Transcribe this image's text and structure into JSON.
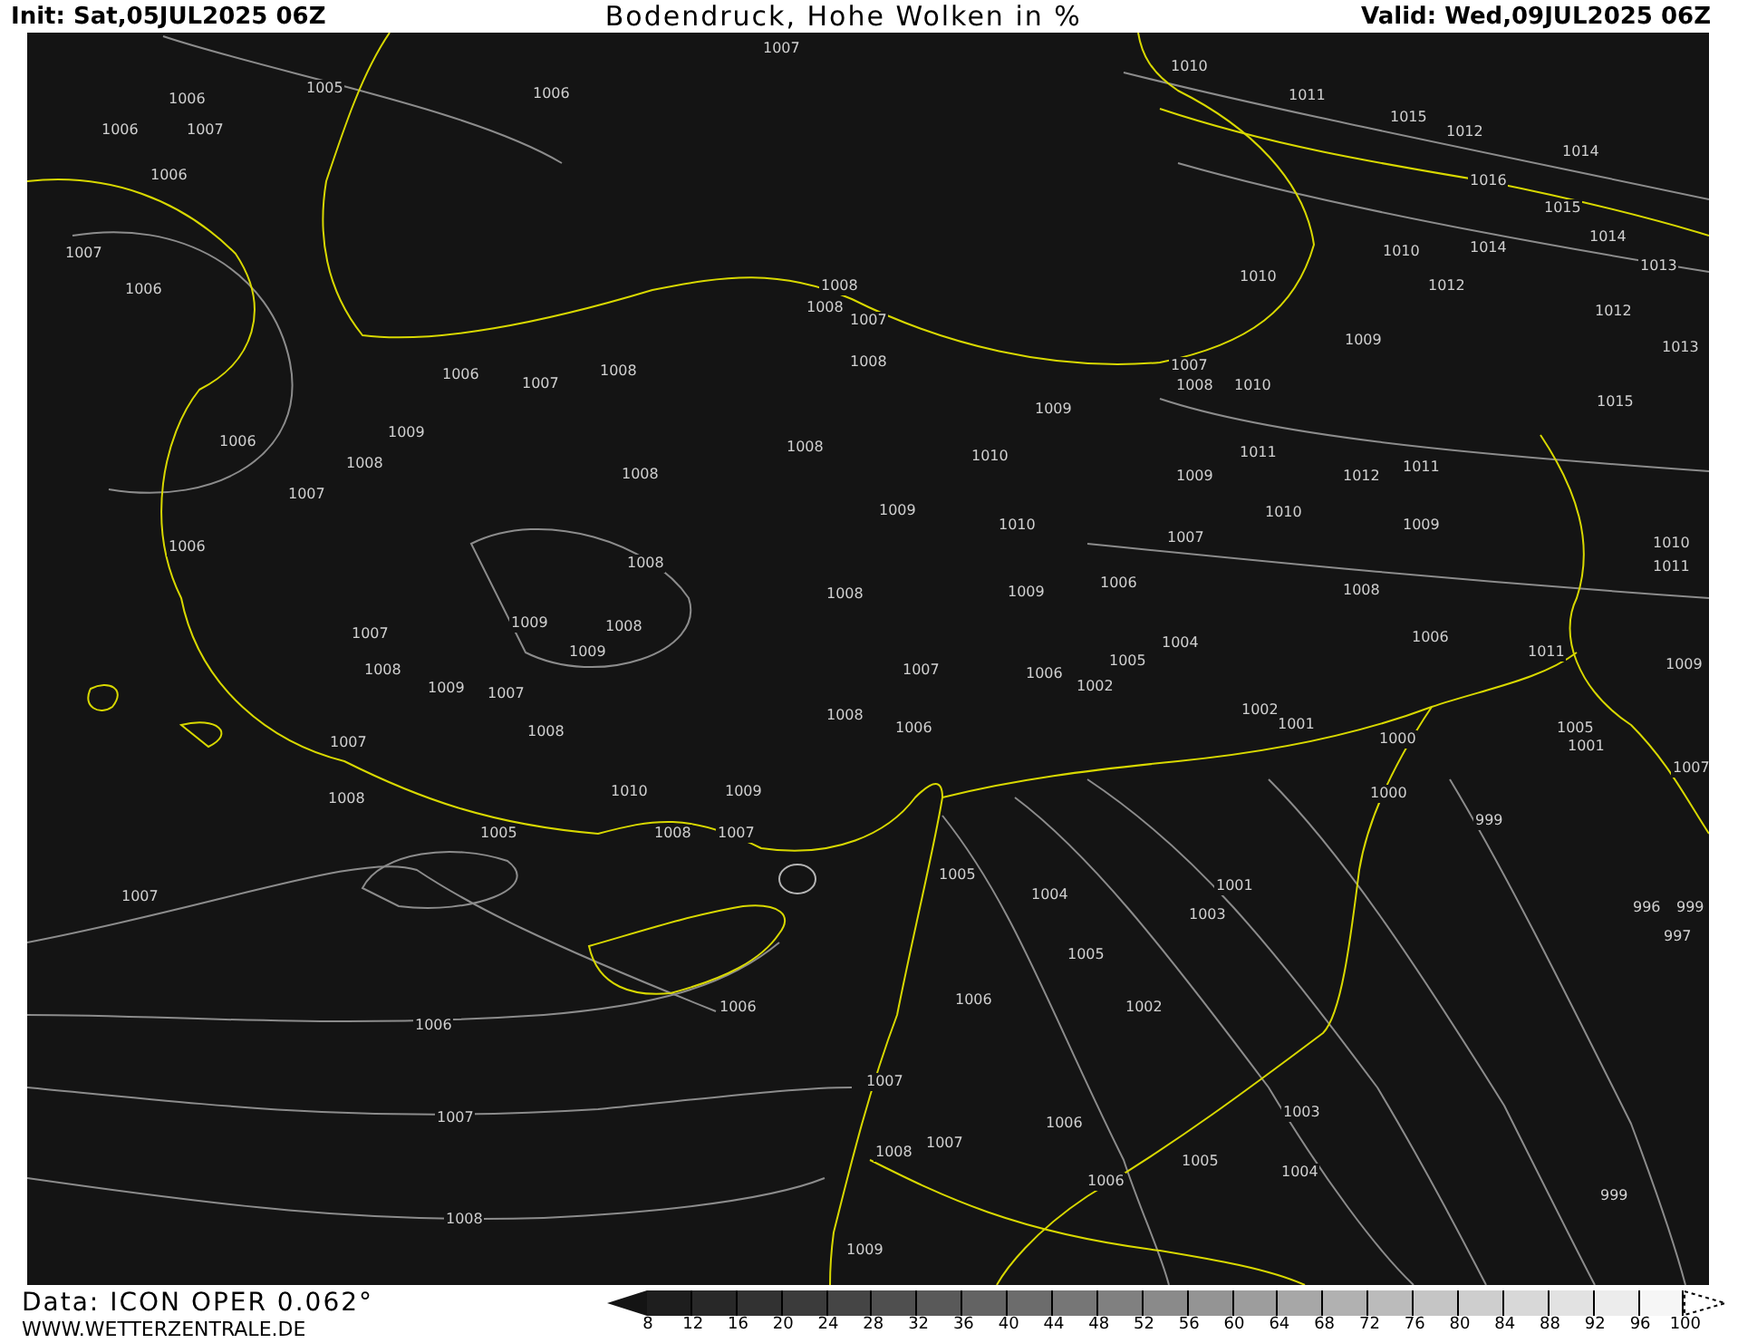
{
  "header": {
    "init": "Init: Sat,05JUL2025 06Z",
    "title": "Bodendruck, Hohe Wolken in %",
    "valid": "Valid: Wed,09JUL2025 06Z"
  },
  "map": {
    "isobar_labels": [
      "1007",
      "1006",
      "1005",
      "1006",
      "1006",
      "1007",
      "1006",
      "1007",
      "1006",
      "1006",
      "1007",
      "1008",
      "1008",
      "1008",
      "1007",
      "1008",
      "1009",
      "1008",
      "1006",
      "1007",
      "1006",
      "1008",
      "1008",
      "1009",
      "1008",
      "1008",
      "1008",
      "1009",
      "1009",
      "1007",
      "1008",
      "1009",
      "1007",
      "1008",
      "1007",
      "1008",
      "1005",
      "1010",
      "1008",
      "1009",
      "1007",
      "1007",
      "1006",
      "1007",
      "1008",
      "1006",
      "1005",
      "1004",
      "1005",
      "1006",
      "1001",
      "1003",
      "1002",
      "1003",
      "1004",
      "1005",
      "1006",
      "1006",
      "1007",
      "1007",
      "1008",
      "1009",
      "1000",
      "999",
      "1000",
      "1001",
      "1002",
      "999",
      "997",
      "996",
      "999",
      "1007",
      "1008",
      "1010",
      "1009",
      "1010",
      "1010",
      "1009",
      "1006",
      "1004",
      "1005",
      "1002",
      "1007",
      "1006",
      "1008",
      "1006",
      "1010",
      "1010",
      "1011",
      "1015",
      "1012",
      "1014",
      "1016",
      "1015",
      "1014",
      "1013",
      "1012",
      "1013",
      "1015",
      "1010",
      "1014",
      "1012",
      "1009",
      "1011",
      "1012",
      "1011",
      "1010",
      "1009",
      "1008",
      "1006",
      "1011",
      "1009",
      "1010",
      "1011",
      "1007",
      "1005",
      "1001",
      "1007",
      "1009"
    ]
  },
  "footer": {
    "data_source": "Data: ICON OPER 0.062°",
    "website": "WWW.WETTERZENTRALE.DE"
  },
  "legend": {
    "segments": [
      {
        "color": "#1e1e1e"
      },
      {
        "color": "#282828"
      },
      {
        "color": "#323232"
      },
      {
        "color": "#3b3b3b"
      },
      {
        "color": "#454545"
      },
      {
        "color": "#4f4f4f"
      },
      {
        "color": "#595959"
      },
      {
        "color": "#636363"
      },
      {
        "color": "#6c6c6c"
      },
      {
        "color": "#767676"
      },
      {
        "color": "#808080"
      },
      {
        "color": "#8a8a8a"
      },
      {
        "color": "#949494"
      },
      {
        "color": "#9d9d9d"
      },
      {
        "color": "#a7a7a7"
      },
      {
        "color": "#b1b1b1"
      },
      {
        "color": "#bbbbbb"
      },
      {
        "color": "#c5c5c5"
      },
      {
        "color": "#cecece"
      },
      {
        "color": "#d8d8d8"
      },
      {
        "color": "#e2e2e2"
      },
      {
        "color": "#ececec"
      },
      {
        "color": "#f6f6f6"
      }
    ],
    "ticks": [
      "8",
      "12",
      "16",
      "20",
      "24",
      "28",
      "32",
      "36",
      "40",
      "44",
      "48",
      "52",
      "56",
      "60",
      "64",
      "68",
      "72",
      "76",
      "80",
      "84",
      "88",
      "92",
      "96",
      "100"
    ]
  }
}
